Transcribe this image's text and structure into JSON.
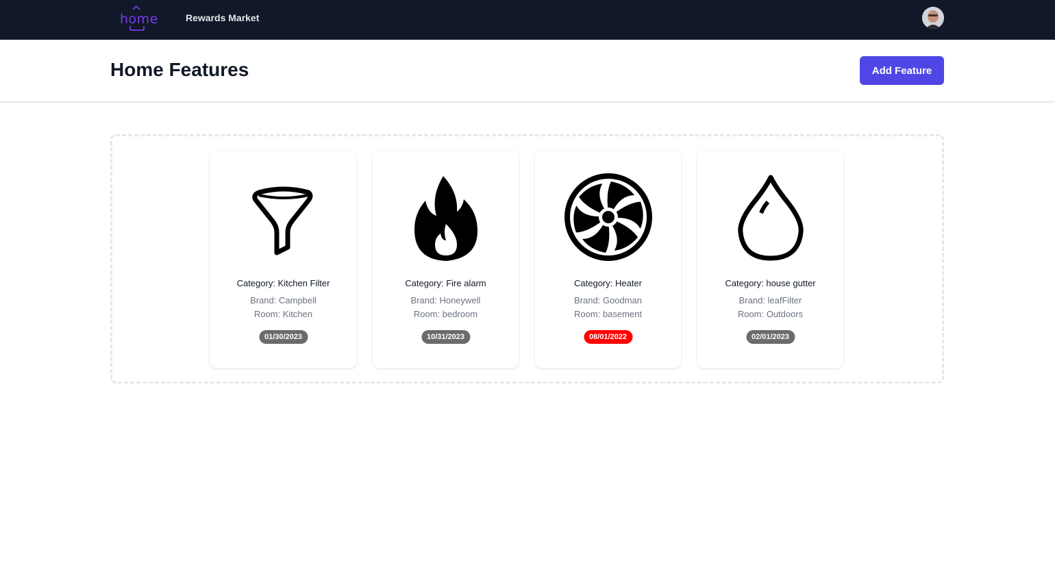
{
  "nav": {
    "logo_text": "home",
    "rewards_link": "Rewards Market"
  },
  "header": {
    "title": "Home Features",
    "add_button": "Add Feature"
  },
  "cards": [
    {
      "icon": "funnel-icon",
      "category": "Category: Kitchen Filter",
      "brand": "Brand: Campbell",
      "room": "Room: Kitchen",
      "date": "01/30/2023",
      "date_color": "#6b6b6b"
    },
    {
      "icon": "fire-icon",
      "category": "Category: Fire alarm",
      "brand": "Brand: Honeywell",
      "room": "Room: bedroom",
      "date": "10/31/2023",
      "date_color": "#6b6b6b"
    },
    {
      "icon": "fan-icon",
      "category": "Category: Heater",
      "brand": "Brand: Goodman",
      "room": "Room: basement",
      "date": "08/01/2022",
      "date_color": "#ff0000"
    },
    {
      "icon": "water-drop-icon",
      "category": "Category: house gutter",
      "brand": "Brand: leafFilter",
      "room": "Room: Outdoors",
      "date": "02/01/2023",
      "date_color": "#6b6b6b"
    }
  ],
  "colors": {
    "nav_bg": "#111827",
    "accent": "#4f46e5",
    "logo": "#7c3aed",
    "overdue": "#ff0000"
  }
}
